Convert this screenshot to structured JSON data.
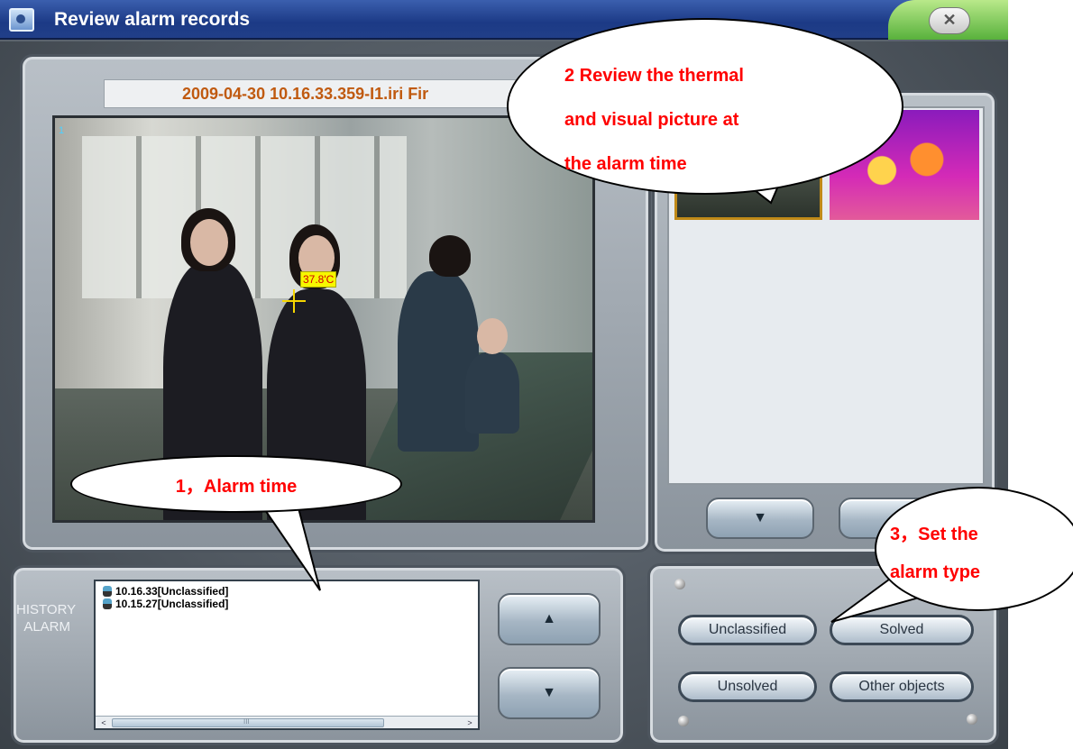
{
  "window": {
    "title": "Review alarm records",
    "close_label": "✕"
  },
  "video": {
    "file_label": "2009-04-30 10.16.33.359-I1.iri Fir",
    "channel": "1",
    "temperature": "37.8'C"
  },
  "history": {
    "label_line1": "HISTORY",
    "label_line2": "ALARM",
    "items": [
      {
        "text": "10.16.33[Unclassified]"
      },
      {
        "text": "10.15.27[Unclassified]"
      }
    ],
    "scroll_left": "<",
    "scroll_right": ">",
    "scroll_grip": "III",
    "up_icon": "▲",
    "down_icon": "▼"
  },
  "thumbs": {
    "down_icon": "▼"
  },
  "classify": {
    "buttons": {
      "unclassified": "Unclassified",
      "solved": "Solved",
      "unsolved": "Unsolved",
      "other_objects": "Other objects"
    }
  },
  "callouts": {
    "c1": "1，Alarm time",
    "c2_line1": "2 Review the thermal",
    "c2_line2": "and visual picture at",
    "c2_line3": "the alarm time",
    "c3_line1": "3，Set the",
    "c3_line2": "alarm type"
  }
}
